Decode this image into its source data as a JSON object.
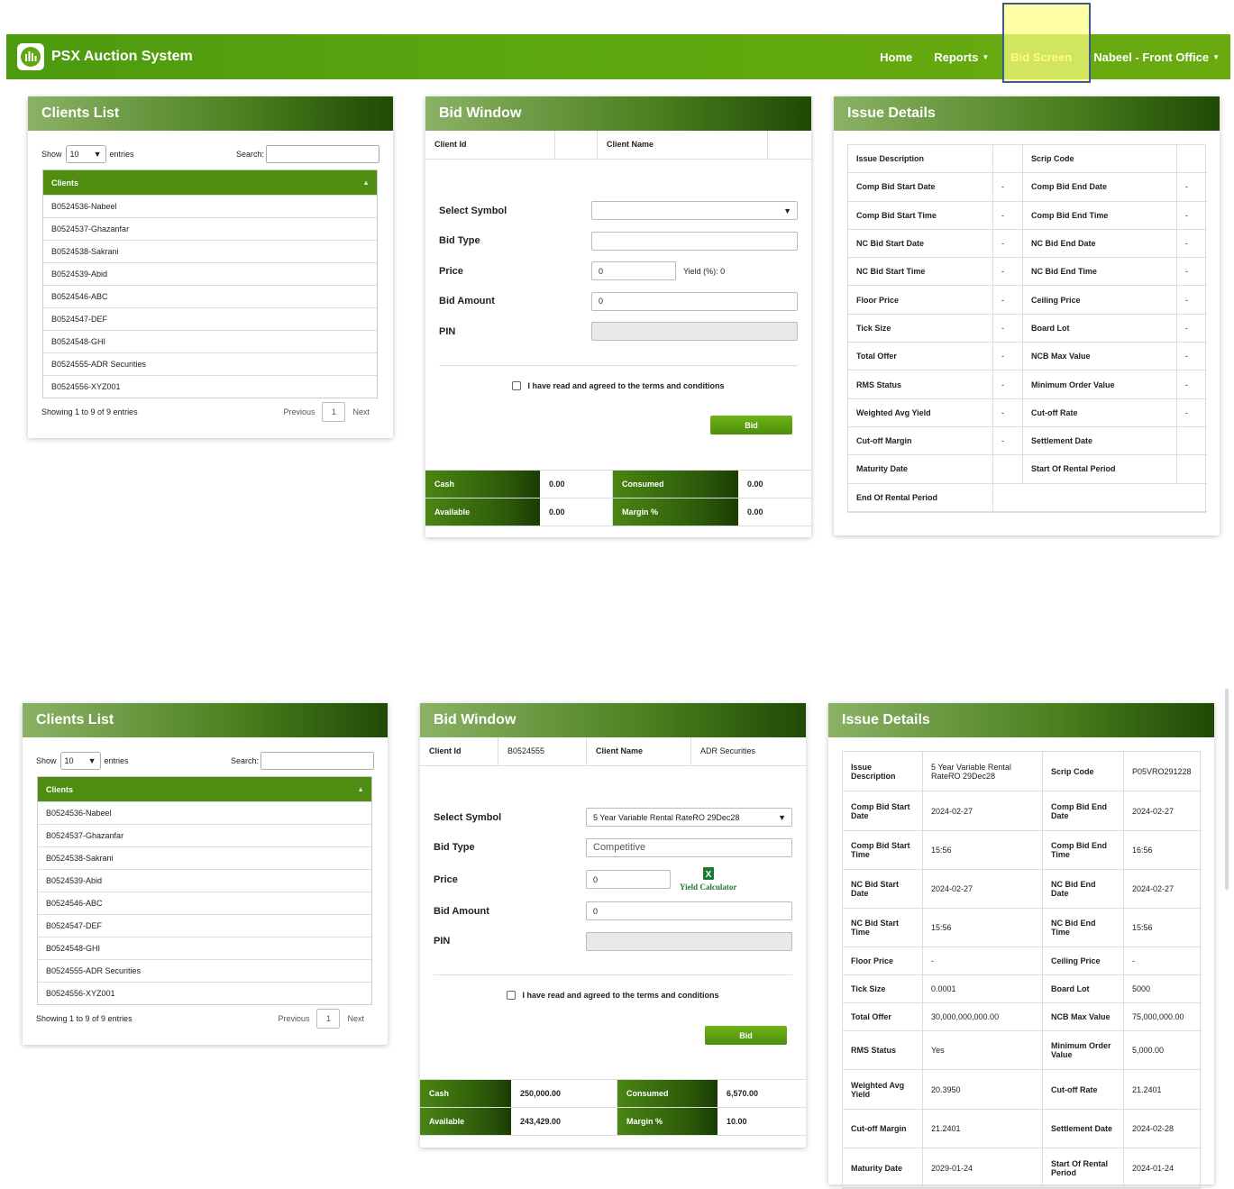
{
  "navbar": {
    "brand": "PSX Auction System",
    "home": "Home",
    "reports": "Reports",
    "bid_screen": "Bid Screen",
    "user": "Nabeel - Front Office"
  },
  "clients_list": {
    "title": "Clients List",
    "show": "Show",
    "entries_value": "10",
    "entries": "entries",
    "search": "Search:",
    "column": "Clients",
    "rows": [
      "B0524536-Nabeel",
      "B0524537-Ghazanfar",
      "B0524538-Sakrani",
      "B0524539-Abid",
      "B0524546-ABC",
      "B0524547-DEF",
      "B0524548-GHI",
      "B0524555-ADR Securities",
      "B0524556-XYZ001"
    ],
    "showing": "Showing 1 to 9 of 9 entries",
    "previous": "Previous",
    "page": "1",
    "next": "Next"
  },
  "bid_window": {
    "title": "Bid Window",
    "client_id_label": "Client Id",
    "client_name_label": "Client Name",
    "select_symbol": "Select Symbol",
    "bid_type": "Bid Type",
    "price": "Price",
    "bid_amount": "Bid Amount",
    "pin": "PIN",
    "terms": "I have read and agreed to the terms and conditions",
    "bid_button": "Bid",
    "cash": "Cash",
    "consumed": "Consumed",
    "available": "Available",
    "margin": "Margin %"
  },
  "issue_details": {
    "title": "Issue Details",
    "labels": [
      "Issue Description",
      "Scrip Code",
      "Comp Bid Start Date",
      "Comp Bid End Date",
      "Comp Bid Start Time",
      "Comp Bid End Time",
      "NC Bid Start Date",
      "NC Bid End Date",
      "NC Bid Start Time",
      "NC Bid End Time",
      "Floor Price",
      "Ceiling Price",
      "Tick Size",
      "Board Lot",
      "Total Offer",
      "NCB Max Value",
      "RMS Status",
      "Minimum Order Value",
      "Weighted Avg Yield",
      "Cut-off Rate",
      "Cut-off Margin",
      "Settlement Date",
      "Maturity Date",
      "Start Of Rental Period",
      "End Of Rental Period"
    ]
  },
  "state1": {
    "client_id": "",
    "client_name": "",
    "symbol": "",
    "bid_type": "",
    "price": "0",
    "yield": "Yield (%):  0",
    "bid_amount": "0",
    "cash": "0.00",
    "consumed": "0.00",
    "available": "0.00",
    "margin": "0.00",
    "issue_values": [
      "",
      "",
      "-",
      "-",
      "-",
      "-",
      "-",
      "-",
      "-",
      "-",
      "-",
      "-",
      "-",
      "-",
      "-",
      "-",
      "-",
      "-",
      "-",
      "-",
      "-",
      "",
      "",
      "",
      ""
    ]
  },
  "state2": {
    "client_id": "B0524555",
    "client_name": "ADR Securities",
    "symbol": "5 Year Variable Rental RateRO 29Dec28",
    "bid_type": "Competitive",
    "price": "0",
    "yield_calc": "Yield Calculator",
    "bid_amount": "0",
    "cash": "250,000.00",
    "consumed": "6,570.00",
    "available": "243,429.00",
    "margin": "10.00",
    "issue_values": [
      "5 Year Variable Rental RateRO 29Dec28",
      "P05VRO291228",
      "2024-02-27",
      "2024-02-27",
      "15:56",
      "16:56",
      "2024-02-27",
      "2024-02-27",
      "15:56",
      "15:56",
      "-",
      "-",
      "0.0001",
      "5000",
      "30,000,000,000.00",
      "75,000,000.00",
      "Yes",
      "5,000.00",
      "20.3950",
      "21.2401",
      "21.2401",
      "2024-02-28",
      "2029-01-24",
      "2024-01-24"
    ]
  }
}
